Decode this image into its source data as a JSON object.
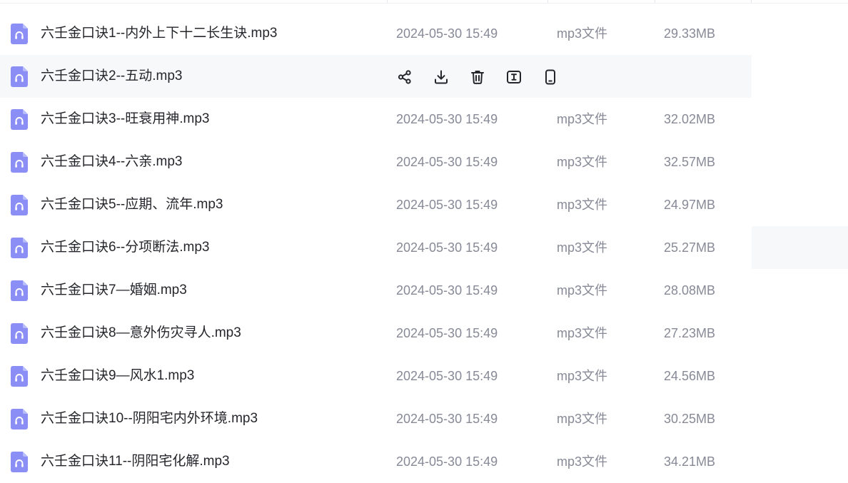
{
  "colors": {
    "icon_fill": "#8b8ff5",
    "icon_fold": "#b9bcfa",
    "hover_bg": "#f7f8fa",
    "muted_text": "#878a96",
    "action_icon": "#25262b"
  },
  "row_actions": [
    {
      "name": "share-icon"
    },
    {
      "name": "download-icon"
    },
    {
      "name": "trash-icon"
    },
    {
      "name": "rename-icon"
    },
    {
      "name": "phone-icon"
    }
  ],
  "files": [
    {
      "name": "六壬金口诀1--内外上下十二长生诀.mp3",
      "date": "2024-05-30 15:49",
      "type": "mp3文件",
      "size": "29.33MB",
      "icon": "audio-file-icon"
    },
    {
      "name": "六壬金口诀2--五动.mp3",
      "date": "",
      "type": "",
      "size": "",
      "icon": "audio-file-icon",
      "hovered": true
    },
    {
      "name": "六壬金口诀3--旺衰用神.mp3",
      "date": "2024-05-30 15:49",
      "type": "mp3文件",
      "size": "32.02MB",
      "icon": "audio-file-icon"
    },
    {
      "name": "六壬金口诀4--六亲.mp3",
      "date": "2024-05-30 15:49",
      "type": "mp3文件",
      "size": "32.57MB",
      "icon": "audio-file-icon"
    },
    {
      "name": "六壬金口诀5--应期、流年.mp3",
      "date": "2024-05-30 15:49",
      "type": "mp3文件",
      "size": "24.97MB",
      "icon": "audio-file-icon"
    },
    {
      "name": "六壬金口诀6--分项断法.mp3",
      "date": "2024-05-30 15:49",
      "type": "mp3文件",
      "size": "25.27MB",
      "icon": "audio-file-icon"
    },
    {
      "name": "六壬金口诀7—婚姻.mp3",
      "date": "2024-05-30 15:49",
      "type": "mp3文件",
      "size": "28.08MB",
      "icon": "audio-file-icon"
    },
    {
      "name": "六壬金口诀8—意外伤灾寻人.mp3",
      "date": "2024-05-30 15:49",
      "type": "mp3文件",
      "size": "27.23MB",
      "icon": "audio-file-icon"
    },
    {
      "name": "六壬金口诀9—风水1.mp3",
      "date": "2024-05-30 15:49",
      "type": "mp3文件",
      "size": "24.56MB",
      "icon": "audio-file-icon"
    },
    {
      "name": "六壬金口诀10--阴阳宅内外环境.mp3",
      "date": "2024-05-30 15:49",
      "type": "mp3文件",
      "size": "30.25MB",
      "icon": "audio-file-icon"
    },
    {
      "name": "六壬金口诀11--阴阳宅化解.mp3",
      "date": "2024-05-30 15:49",
      "type": "mp3文件",
      "size": "34.21MB",
      "icon": "audio-file-icon"
    }
  ]
}
